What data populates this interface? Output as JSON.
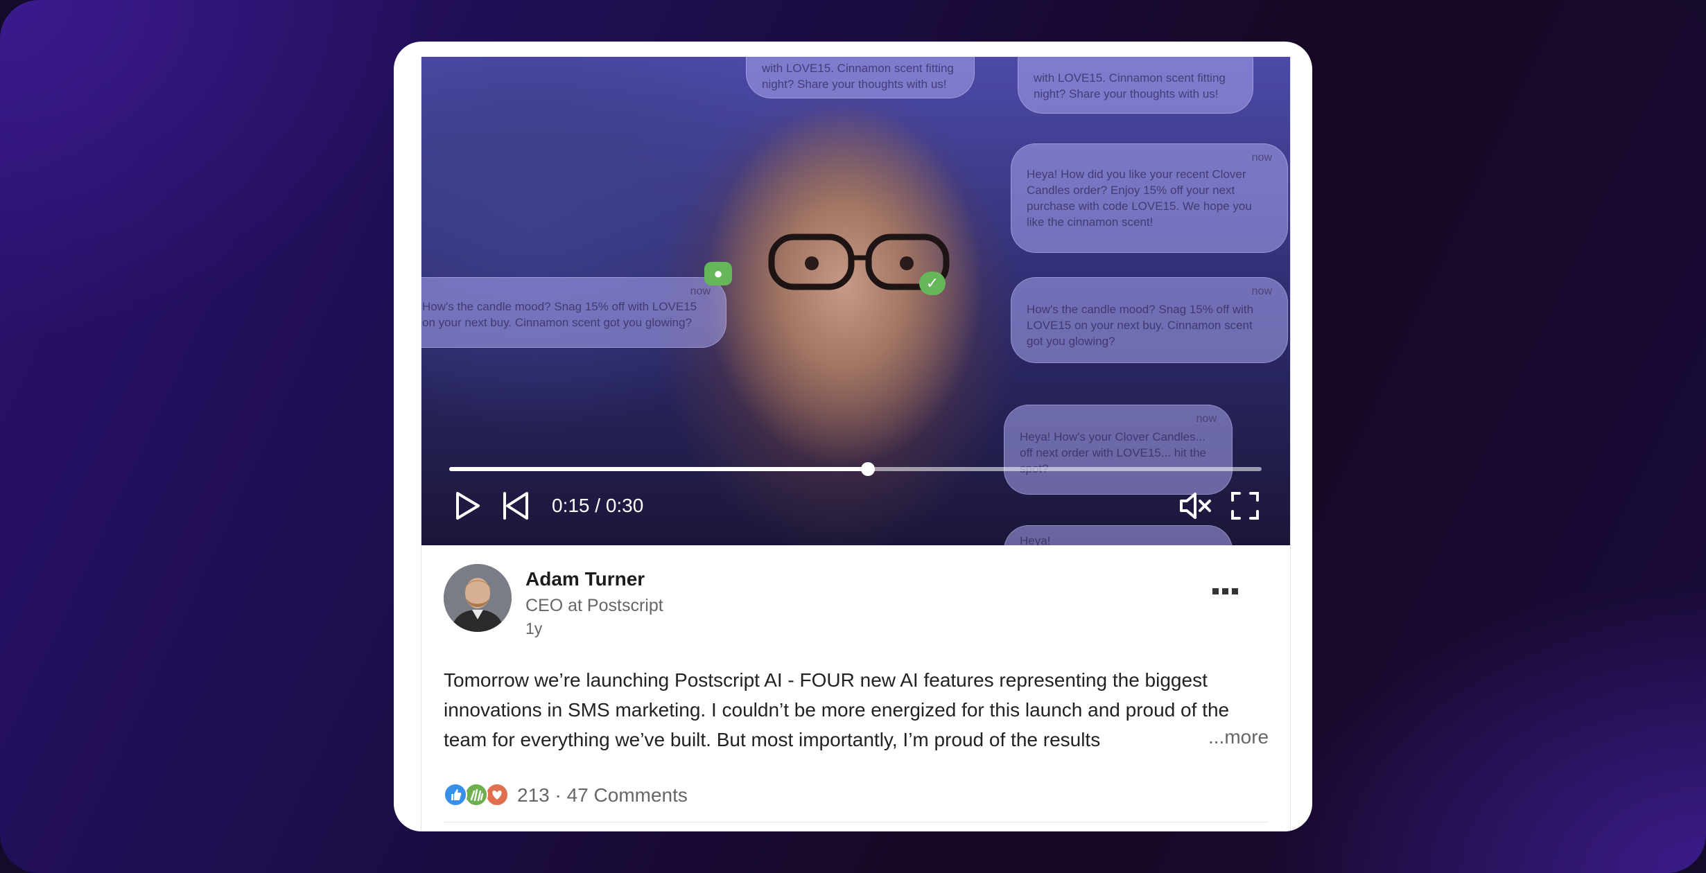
{
  "video": {
    "current_time": "0:15",
    "duration": "0:30",
    "time_display": "0:15 / 0:30",
    "progress": 0.515,
    "muted": true,
    "bubbles": [
      {
        "text": "with LOVE15. Cinnamon scent fitting night? Share your thoughts with us!",
        "time": ""
      },
      {
        "text": "Heya! How did you like your recent Clover Candles order? Enjoy 15% off your next purchase with code LOVE15. We hope you like the cinnamon scent!",
        "time": "now"
      },
      {
        "text": "How's the candle mood? Snag 15% off with LOVE15 on your next buy. Cinnamon scent got you glowing?",
        "time": "now"
      },
      {
        "text": "How's the candle mood? Snag 15% off with LOVE15 on your next buy. Cinnamon scent got you glowing?",
        "time": "now"
      },
      {
        "text": "Heya! How's your Clover Candles... off next order with LOVE15... hit the spot?",
        "time": "now"
      },
      {
        "text": "Heya!",
        "time": ""
      }
    ]
  },
  "post": {
    "author_name": "Adam Turner",
    "author_headline": "CEO at Postscript",
    "posted_ago": "1y",
    "body": "Tomorrow we’re launching Postscript AI - FOUR new AI features representing the biggest innovations in SMS marketing. I couldn’t be more energized for this launch and proud of the team for everything we’ve built. But most importantly, I’m proud of the results",
    "see_more_label": "...more",
    "reaction_count": "213",
    "separator": "·",
    "comments_label": "47 Comments",
    "reaction_icons": [
      "like-icon",
      "celebrate-icon",
      "love-icon"
    ]
  },
  "colors": {
    "like": "#378fe9",
    "celebrate": "#6dae4f",
    "love": "#df704d",
    "text_primary": "#1c1c1c",
    "text_secondary": "#666666"
  }
}
